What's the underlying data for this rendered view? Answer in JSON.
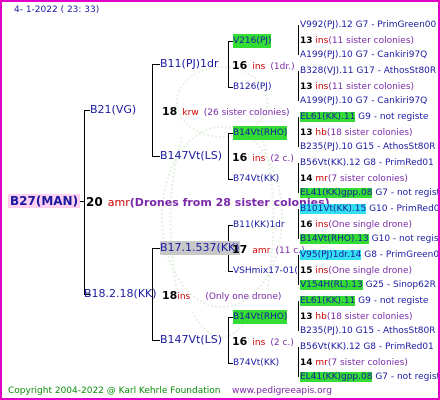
{
  "header": {
    "date": "4-  1-2022 ( 23: 33)"
  },
  "root": {
    "name": "B27(MAN)"
  },
  "root_info": {
    "num": "20",
    "unit": "amr",
    "note": "(Drones from 28 sister colonies)"
  },
  "gen1": [
    {
      "name": "B21(VG)",
      "num": "18",
      "unit": "krw",
      "note": "(26 sister colonies)"
    },
    {
      "name": "B18.2.18(KK)",
      "num": "18",
      "unit": "ins",
      "note": "(Only one drone)"
    }
  ],
  "gen2": [
    {
      "name": "B11(PJ)1dr",
      "num": "16",
      "unit": "ins",
      "note": "(1dr.)"
    },
    {
      "name": "B147Vt(LS)",
      "num": "16",
      "unit": "ins",
      "note": "(2 c.)"
    },
    {
      "name": "B17.1.537(KK)",
      "num": "17",
      "unit": "amr",
      "note": "(11 c.)"
    },
    {
      "name": "B147Vt(LS)",
      "num": "16",
      "unit": "ins",
      "note": "(2 c.)"
    }
  ],
  "gen3": [
    {
      "name": "V216(PJ)",
      "num": "13",
      "unit": "ins",
      "note": "(11 sister colonies)"
    },
    {
      "name": "B126(PJ)",
      "num": "13",
      "unit": "ins",
      "note": "(11 sister colonies)"
    },
    {
      "name": "B14Vt(RHO)",
      "num": "13",
      "unit": "hb",
      "note": "(18 sister colonies)"
    },
    {
      "name": "B74Vt(KK)",
      "num": "14",
      "unit": "mr",
      "note": "(7 sister colonies)"
    },
    {
      "name": "B11(KK)1dr",
      "num": "16",
      "unit": "ins",
      "note": "(One single drone)"
    },
    {
      "name": "VSHmix17-01(",
      "num": "15",
      "unit": "ins",
      "note": "(One single drone)"
    },
    {
      "name": "B14Vt(RHO)",
      "num": "13",
      "unit": "hb",
      "note": "(18 sister colonies)"
    },
    {
      "name": "B74Vt(KK)",
      "num": "14",
      "unit": "mr",
      "note": "(7 sister colonies)"
    }
  ],
  "gen4": [
    {
      "name": "V992(PJ).12",
      "tail": "G7 - PrimGreen00"
    },
    {
      "name": "A199(PJ).10",
      "tail": "G7 - Cankiri97Q"
    },
    {
      "name": "B328(VJ).11",
      "tail": "G17 - AthosSt80R"
    },
    {
      "name": "A199(PJ).10",
      "tail": "G7 - Cankiri97Q"
    },
    {
      "name": "EL61(KK).11",
      "tail": "G9 - not registe"
    },
    {
      "name": "B235(PJ).10",
      "tail": "G15 - AthosSt80R"
    },
    {
      "name": "B56Vt(KK).12",
      "tail": "G8 - PrimRed01"
    },
    {
      "name": "EL41(KK)gpp.08",
      "tail": "G7 - not registe"
    },
    {
      "name": "B101Vt(KK).15",
      "tail": "G10 - PrimRed01"
    },
    {
      "name": "B14Vt(RHO).13",
      "tail": "G10 - not registe"
    },
    {
      "name": "V95(PJ)1dr.14",
      "tail": "G8 - PrimGreen00"
    },
    {
      "name": "V154H(RL).13",
      "tail": "G25 - Sinop62R"
    },
    {
      "name": "EL61(KK).11",
      "tail": "G9 - not registe"
    },
    {
      "name": "B235(PJ).10",
      "tail": "G15 - AthosSt80R"
    },
    {
      "name": "B56Vt(KK).12",
      "tail": "G8 - PrimRed01"
    },
    {
      "name": "EL41(KK)gpp.08",
      "tail": "G7 - not registe"
    }
  ],
  "footer": {
    "copyright": "Copyright 2004-2022 @ Karl Kehrle Foundation",
    "site": "www.pedigreeapis.org"
  }
}
